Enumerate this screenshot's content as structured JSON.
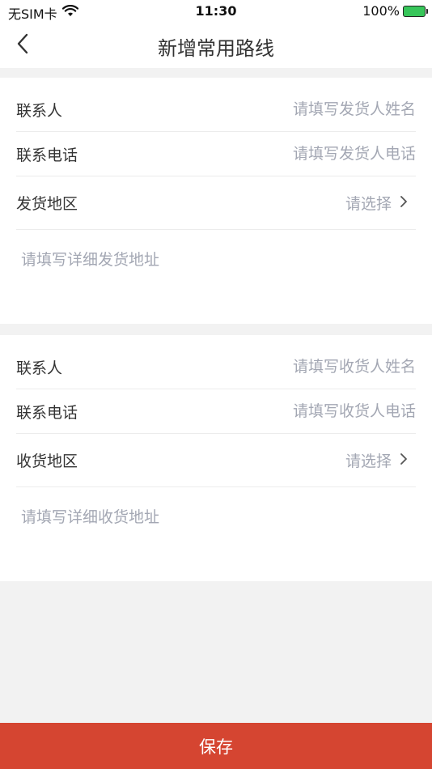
{
  "status_bar": {
    "carrier": "无SIM卡",
    "time": "11:30",
    "battery": "100%"
  },
  "nav": {
    "title": "新增常用路线"
  },
  "sender": {
    "contact_label": "联系人",
    "contact_placeholder": "请填写发货人姓名",
    "phone_label": "联系电话",
    "phone_placeholder": "请填写发货人电话",
    "region_label": "发货地区",
    "region_value": "请选择",
    "address_placeholder": "请填写详细发货地址"
  },
  "receiver": {
    "contact_label": "联系人",
    "contact_placeholder": "请填写收货人姓名",
    "phone_label": "联系电话",
    "phone_placeholder": "请填写收货人电话",
    "region_label": "收货地区",
    "region_value": "请选择",
    "address_placeholder": "请填写详细收货地址"
  },
  "footer": {
    "save_label": "保存"
  },
  "colors": {
    "accent": "#d54531",
    "placeholder": "#a3a7b3",
    "background": "#f2f2f2"
  }
}
